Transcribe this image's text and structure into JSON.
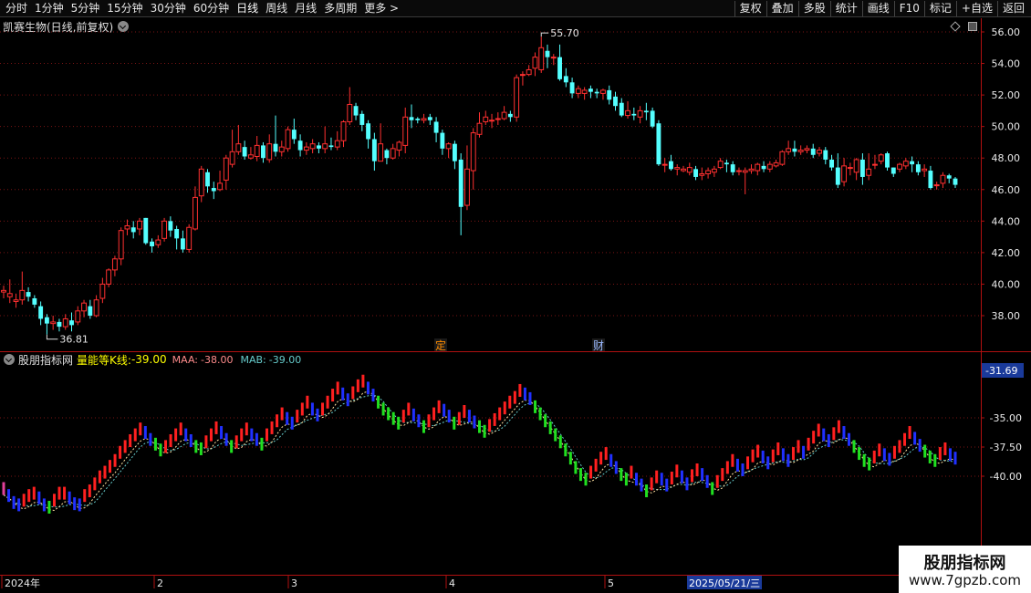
{
  "toolbar": {
    "periods": [
      "分时",
      "1分钟",
      "5分钟",
      "15分钟",
      "30分钟",
      "60分钟",
      "日线",
      "周线",
      "月线",
      "多周期",
      "更多 >"
    ],
    "active_period": "日线",
    "actions": [
      "复权",
      "叠加",
      "多股",
      "统计",
      "画线",
      "F10",
      "标记",
      "+自选",
      "返回"
    ]
  },
  "main_chart": {
    "stock_title": "凯赛生物(日线,前复权)",
    "y_ticks": [
      "56.00",
      "54.00",
      "52.00",
      "50.00",
      "48.00",
      "46.00",
      "44.00",
      "42.00",
      "40.00",
      "38.00"
    ],
    "high_label": "55.70",
    "low_label": "36.81",
    "event_markers": [
      {
        "text": "定",
        "color": "#ff8c00"
      },
      {
        "text": "财",
        "color": "#9ab8ff"
      }
    ],
    "up_color": "#ff3030",
    "down_color": "#54ffff"
  },
  "indicator": {
    "source": "股朋指标网",
    "name": "量能等K线:",
    "main_value": "-39.00",
    "maa_label": "MAA:",
    "maa_value": "-38.00",
    "mab_label": "MAB:",
    "mab_value": "-39.00",
    "y_ticks": [
      "-35.00",
      "-37.50",
      "-40.00"
    ],
    "current_value": "-31.69",
    "colors": {
      "name": "#ffff00",
      "maa": "#ff8c8c",
      "mab": "#66cccc"
    }
  },
  "time_axis": {
    "labels": [
      "2024年",
      "2",
      "3",
      "4",
      "5"
    ],
    "cursor_date": "2025/05/21/三"
  },
  "watermark": {
    "title": "股朋指标网",
    "url": "www.7gpzb.com"
  },
  "chart_data": {
    "type": "candlestick",
    "candles": [
      [
        39.5,
        39.6,
        39.1,
        39.9
      ],
      [
        39.2,
        39.4,
        38.8,
        40.3
      ],
      [
        38.9,
        39.0,
        38.5,
        39.4
      ],
      [
        39.0,
        39.6,
        38.7,
        40.8
      ],
      [
        39.5,
        39.2,
        38.9,
        39.8
      ],
      [
        39.1,
        38.7,
        38.5,
        39.3
      ],
      [
        38.6,
        37.8,
        37.4,
        38.9
      ],
      [
        37.9,
        37.5,
        36.8,
        38.1
      ],
      [
        37.5,
        37.6,
        37.1,
        38.0
      ],
      [
        37.6,
        37.3,
        37.0,
        37.8
      ],
      [
        37.3,
        37.8,
        37.1,
        38.1
      ],
      [
        37.7,
        37.4,
        37.0,
        38.2
      ],
      [
        37.6,
        38.3,
        37.4,
        38.6
      ],
      [
        38.3,
        38.8,
        37.9,
        39.0
      ],
      [
        38.6,
        38.0,
        37.8,
        39.0
      ],
      [
        38.0,
        39.0,
        37.9,
        39.3
      ],
      [
        39.1,
        40.0,
        38.8,
        40.4
      ],
      [
        40.0,
        40.9,
        39.8,
        41.0
      ],
      [
        40.9,
        41.6,
        40.5,
        41.8
      ],
      [
        41.6,
        43.4,
        41.2,
        43.6
      ],
      [
        43.5,
        43.7,
        43.1,
        44.1
      ],
      [
        43.6,
        43.3,
        42.9,
        44.0
      ],
      [
        43.5,
        44.0,
        43.1,
        44.2
      ],
      [
        44.2,
        42.6,
        42.5,
        44.2
      ],
      [
        42.7,
        42.4,
        42.0,
        42.9
      ],
      [
        42.5,
        42.8,
        42.3,
        43.1
      ],
      [
        42.9,
        44.0,
        42.7,
        44.2
      ],
      [
        44.0,
        43.4,
        43.0,
        44.3
      ],
      [
        43.5,
        42.9,
        42.2,
        43.7
      ],
      [
        42.9,
        42.2,
        42.0,
        43.4
      ],
      [
        42.2,
        43.6,
        42.0,
        43.8
      ],
      [
        43.5,
        45.5,
        43.4,
        46.2
      ],
      [
        45.6,
        47.3,
        45.2,
        47.5
      ],
      [
        47.1,
        46.2,
        45.8,
        47.3
      ],
      [
        46.1,
        45.9,
        45.4,
        46.5
      ],
      [
        46.0,
        46.4,
        45.9,
        47.2
      ],
      [
        46.6,
        48.0,
        46.0,
        48.2
      ],
      [
        47.6,
        48.4,
        47.4,
        49.8
      ],
      [
        48.4,
        48.9,
        48.2,
        50.1
      ],
      [
        48.7,
        48.1,
        47.9,
        49.1
      ],
      [
        48.0,
        48.2,
        47.9,
        48.7
      ],
      [
        48.1,
        48.8,
        47.8,
        49.4
      ],
      [
        48.8,
        48.0,
        47.7,
        49.0
      ],
      [
        47.9,
        48.9,
        47.7,
        49.5
      ],
      [
        48.9,
        48.4,
        48.1,
        50.7
      ],
      [
        48.4,
        48.7,
        48.1,
        49.1
      ],
      [
        48.6,
        49.8,
        48.4,
        50.0
      ],
      [
        49.8,
        49.2,
        48.9,
        50.5
      ],
      [
        49.1,
        48.5,
        48.1,
        49.5
      ],
      [
        48.5,
        48.7,
        48.2,
        49.0
      ],
      [
        48.6,
        48.9,
        48.3,
        49.2
      ],
      [
        48.8,
        48.6,
        48.3,
        49.0
      ],
      [
        48.6,
        48.9,
        48.3,
        50.0
      ],
      [
        48.8,
        48.7,
        48.5,
        49.3
      ],
      [
        48.7,
        49.1,
        48.5,
        49.7
      ],
      [
        49.1,
        50.3,
        48.7,
        50.4
      ],
      [
        50.3,
        51.4,
        50.1,
        52.5
      ],
      [
        51.3,
        50.7,
        50.4,
        51.5
      ],
      [
        50.8,
        50.1,
        49.7,
        51.0
      ],
      [
        50.2,
        49.2,
        48.6,
        50.4
      ],
      [
        49.2,
        47.8,
        47.2,
        49.6
      ],
      [
        47.8,
        48.9,
        48.1,
        50.2
      ],
      [
        48.5,
        48.0,
        47.6,
        48.6
      ],
      [
        48.0,
        48.6,
        47.9,
        48.9
      ],
      [
        48.5,
        49.0,
        48.1,
        49.1
      ],
      [
        48.8,
        50.6,
        48.3,
        51.2
      ],
      [
        50.6,
        50.4,
        49.9,
        51.4
      ],
      [
        50.5,
        50.4,
        50.2,
        50.6
      ],
      [
        50.4,
        50.5,
        50.2,
        50.8
      ],
      [
        50.6,
        50.4,
        50.1,
        50.8
      ],
      [
        50.3,
        49.6,
        49.0,
        50.6
      ],
      [
        49.6,
        48.6,
        48.2,
        49.8
      ],
      [
        48.6,
        48.9,
        48.0,
        49.0
      ],
      [
        48.9,
        47.8,
        47.3,
        49.1
      ],
      [
        47.9,
        44.9,
        43.1,
        48.3
      ],
      [
        45.0,
        47.3,
        44.7,
        48.8
      ],
      [
        47.2,
        49.6,
        46.0,
        49.9
      ],
      [
        49.5,
        50.2,
        49.3,
        50.9
      ],
      [
        50.3,
        50.6,
        50.1,
        51.0
      ],
      [
        50.4,
        50.4,
        49.9,
        50.8
      ],
      [
        50.5,
        50.5,
        50.1,
        50.9
      ],
      [
        50.5,
        50.9,
        50.4,
        51.3
      ],
      [
        50.8,
        50.6,
        50.3,
        51.0
      ],
      [
        50.6,
        53.1,
        50.3,
        53.3
      ],
      [
        53.3,
        53.3,
        52.6,
        53.5
      ],
      [
        53.3,
        53.6,
        53.2,
        53.9
      ],
      [
        53.7,
        54.4,
        53.2,
        54.7
      ],
      [
        53.6,
        55.0,
        53.4,
        55.7
      ],
      [
        54.8,
        54.4,
        53.7,
        55.2
      ],
      [
        54.4,
        54.4,
        53.9,
        54.6
      ],
      [
        54.4,
        53.0,
        52.9,
        55.2
      ],
      [
        53.2,
        52.8,
        52.5,
        53.7
      ],
      [
        52.8,
        52.1,
        51.8,
        53.1
      ],
      [
        52.1,
        52.4,
        51.8,
        52.6
      ],
      [
        52.1,
        52.3,
        51.7,
        52.5
      ],
      [
        52.4,
        52.2,
        51.8,
        52.6
      ],
      [
        52.2,
        52.1,
        51.8,
        52.4
      ],
      [
        52.1,
        52.3,
        51.7,
        52.4
      ],
      [
        52.3,
        51.7,
        51.4,
        52.6
      ],
      [
        51.9,
        51.3,
        51.0,
        52.2
      ],
      [
        51.5,
        50.7,
        50.6,
        51.8
      ],
      [
        50.7,
        51.0,
        50.5,
        51.6
      ],
      [
        50.8,
        50.7,
        50.4,
        51.2
      ],
      [
        50.6,
        51.0,
        50.2,
        51.3
      ],
      [
        51.0,
        50.9,
        50.4,
        51.5
      ],
      [
        51.0,
        50.0,
        49.9,
        51.2
      ],
      [
        50.2,
        47.6,
        47.5,
        50.4
      ],
      [
        47.6,
        47.6,
        47.1,
        48.0
      ],
      [
        47.8,
        47.3,
        47.2,
        48.2
      ],
      [
        47.3,
        47.4,
        46.9,
        47.6
      ],
      [
        47.2,
        47.3,
        47.1,
        47.5
      ],
      [
        47.1,
        47.4,
        46.9,
        47.7
      ],
      [
        47.3,
        46.8,
        46.6,
        47.5
      ],
      [
        46.9,
        47.0,
        46.6,
        47.4
      ],
      [
        47.0,
        47.2,
        46.7,
        47.4
      ],
      [
        47.1,
        47.3,
        46.8,
        47.5
      ],
      [
        47.4,
        47.8,
        47.3,
        48.0
      ],
      [
        47.7,
        47.6,
        47.1,
        47.9
      ],
      [
        47.6,
        47.1,
        46.9,
        47.8
      ],
      [
        47.2,
        47.2,
        46.9,
        47.4
      ],
      [
        47.1,
        47.2,
        45.7,
        47.4
      ],
      [
        47.2,
        47.3,
        47.0,
        47.6
      ],
      [
        47.2,
        47.6,
        46.9,
        47.7
      ],
      [
        47.5,
        47.3,
        47.1,
        47.8
      ],
      [
        47.3,
        47.6,
        47.1,
        47.8
      ],
      [
        47.5,
        47.7,
        47.4,
        47.9
      ],
      [
        47.6,
        48.4,
        47.5,
        48.5
      ],
      [
        48.4,
        48.6,
        48.2,
        49.1
      ],
      [
        48.6,
        48.4,
        48.1,
        49.1
      ],
      [
        48.4,
        48.5,
        48.2,
        48.8
      ],
      [
        48.5,
        48.6,
        48.3,
        48.8
      ],
      [
        48.6,
        48.2,
        48.0,
        48.9
      ],
      [
        48.3,
        48.5,
        48.1,
        48.7
      ],
      [
        48.5,
        47.9,
        47.6,
        48.7
      ],
      [
        47.9,
        47.4,
        47.2,
        48.2
      ],
      [
        47.4,
        46.3,
        46.1,
        48.3
      ],
      [
        46.5,
        47.5,
        46.2,
        48.0
      ],
      [
        47.4,
        47.4,
        46.9,
        47.7
      ],
      [
        47.1,
        47.9,
        46.6,
        48.0
      ],
      [
        47.9,
        46.8,
        46.3,
        48.3
      ],
      [
        46.9,
        47.3,
        46.6,
        48.3
      ],
      [
        47.6,
        47.6,
        47.3,
        48.2
      ],
      [
        47.8,
        48.2,
        47.6,
        48.3
      ],
      [
        48.3,
        47.4,
        47.2,
        48.4
      ],
      [
        47.4,
        47.0,
        46.8,
        47.4
      ],
      [
        47.3,
        47.6,
        47.1,
        47.7
      ],
      [
        47.5,
        47.8,
        47.3,
        48.0
      ],
      [
        47.8,
        47.6,
        47.1,
        48.1
      ],
      [
        47.6,
        47.1,
        46.9,
        47.8
      ],
      [
        47.2,
        47.3,
        46.8,
        47.6
      ],
      [
        47.2,
        46.1,
        46.0,
        47.5
      ],
      [
        46.3,
        46.3,
        46.0,
        46.5
      ],
      [
        46.4,
        46.9,
        46.1,
        47.1
      ],
      [
        46.9,
        46.7,
        46.4,
        47.0
      ],
      [
        46.7,
        46.3,
        46.1,
        46.8
      ]
    ],
    "y_range": [
      36.81,
      55.7
    ],
    "indicator": {
      "name": "量能等K线",
      "y_range": [
        -43.5,
        -31.69
      ],
      "values": [
        -41.6,
        -42.2,
        -42.8,
        -43.0,
        -42.6,
        -42.2,
        -42.0,
        -42.4,
        -43.0,
        -43.2,
        -42.6,
        -42.0,
        -42.0,
        -42.4,
        -42.9,
        -43.0,
        -42.2,
        -41.8,
        -41.2,
        -40.6,
        -40.2,
        -39.7,
        -39.2,
        -38.5,
        -38.0,
        -37.5,
        -37.0,
        -36.5,
        -36.8,
        -37.4,
        -37.8,
        -38.3,
        -38.0,
        -37.5,
        -37.0,
        -36.5,
        -37.0,
        -37.5,
        -38.0,
        -38.2,
        -37.6,
        -37.0,
        -36.4,
        -36.8,
        -37.4,
        -38.0,
        -37.6,
        -37.0,
        -36.5,
        -37.0,
        -37.4,
        -37.8,
        -37.0,
        -36.4,
        -35.8,
        -35.2,
        -35.6,
        -36.0,
        -35.4,
        -34.8,
        -34.2,
        -34.8,
        -35.3,
        -34.8,
        -34.2,
        -33.6,
        -33.0,
        -33.5,
        -34.0,
        -33.4,
        -32.8,
        -32.4,
        -33.0,
        -33.6,
        -34.2,
        -34.8,
        -35.2,
        -35.6,
        -36.0,
        -35.4,
        -34.8,
        -35.3,
        -35.8,
        -36.3,
        -35.8,
        -35.2,
        -34.6,
        -34.9,
        -35.4,
        -36.0,
        -35.6,
        -35.0,
        -35.4,
        -35.9,
        -36.3,
        -36.7,
        -36.2,
        -35.7,
        -35.2,
        -34.7,
        -34.2,
        -33.8,
        -33.2,
        -33.5,
        -33.9,
        -34.6,
        -35.2,
        -35.8,
        -36.4,
        -37.0,
        -37.6,
        -38.3,
        -39.0,
        -39.8,
        -40.4,
        -40.8,
        -40.2,
        -39.6,
        -39.0,
        -38.6,
        -39.2,
        -39.8,
        -40.4,
        -40.8,
        -40.2,
        -40.8,
        -41.3,
        -41.8,
        -41.2,
        -40.6,
        -40.8,
        -41.3,
        -40.7,
        -40.1,
        -40.6,
        -41.2,
        -40.5,
        -40.0,
        -40.4,
        -41.0,
        -41.6,
        -41.0,
        -40.4,
        -39.8,
        -39.2,
        -39.6,
        -40.0,
        -39.4,
        -38.8,
        -38.4,
        -38.9,
        -39.4,
        -38.8,
        -38.2,
        -38.7,
        -39.2,
        -38.6,
        -38.0,
        -38.5,
        -37.8,
        -37.2,
        -36.6,
        -37.0,
        -37.5,
        -36.9,
        -36.3,
        -36.8,
        -37.4,
        -38.0,
        -38.6,
        -39.2,
        -39.5,
        -38.9,
        -38.3,
        -38.7,
        -39.1,
        -38.5,
        -38.0,
        -37.4,
        -36.8,
        -37.3,
        -37.9,
        -38.4,
        -38.9,
        -39.2,
        -38.6,
        -38.2,
        -38.7,
        -39.0
      ]
    }
  }
}
